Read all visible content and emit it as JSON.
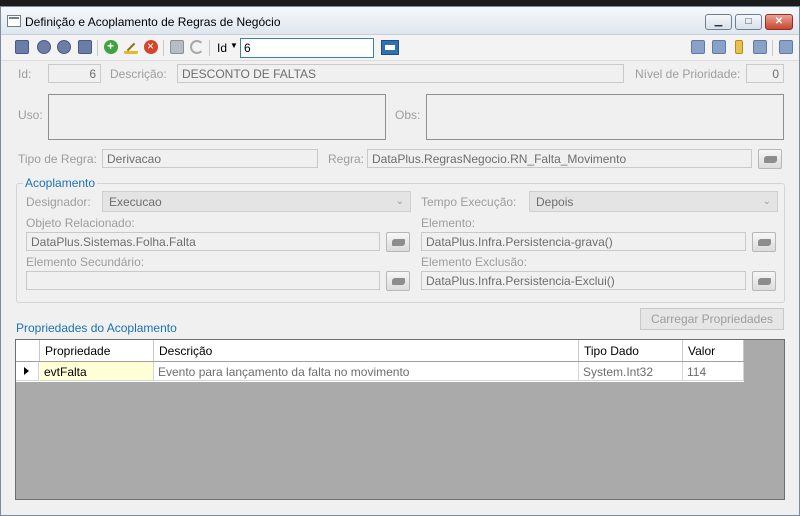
{
  "window": {
    "title": "Definição e Acoplamento de Regras de Negócio"
  },
  "toolbar": {
    "search_field_label": "Id",
    "search_value": "6"
  },
  "header": {
    "id_label": "Id:",
    "id_value": "6",
    "descricao_label": "Descrição:",
    "descricao_value": "DESCONTO DE FALTAS",
    "nivel_label": "Nível de Prioridade:",
    "nivel_value": "0",
    "uso_label": "Uso:",
    "obs_label": "Obs:",
    "tipo_regra_label": "Tipo de Regra:",
    "tipo_regra_value": "Derivacao",
    "regra_label": "Regra:",
    "regra_value": "DataPlus.RegrasNegocio.RN_Falta_Movimento"
  },
  "acoplamento": {
    "title": "Acoplamento",
    "designador_label": "Designador:",
    "designador_value": "Execucao",
    "tempo_label": "Tempo Execução:",
    "tempo_value": "Depois",
    "objeto_label": "Objeto Relacionado:",
    "objeto_value": "DataPlus.Sistemas.Folha.Falta",
    "elemento_label": "Elemento:",
    "elemento_value": "DataPlus.Infra.Persistencia-grava()",
    "secundario_label": "Elemento Secundário:",
    "secundario_value": "",
    "exclusao_label": "Elemento Exclusão:",
    "exclusao_value": "DataPlus.Infra.Persistencia-Exclui()"
  },
  "propriedades": {
    "title": "Propriedades do Acoplamento",
    "load_button": "Carregar Propriedades",
    "columns": [
      "Propriedade",
      "Descrição",
      "Tipo Dado",
      "Valor"
    ],
    "rows": [
      [
        "evtFalta",
        "Evento para lançamento da falta no movimento",
        "System.Int32",
        "114"
      ]
    ]
  }
}
